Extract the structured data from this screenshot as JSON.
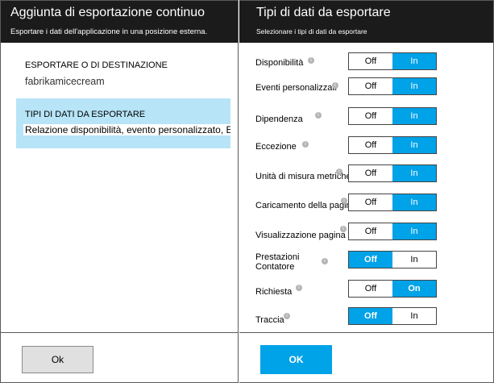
{
  "left_blade": {
    "title": "Aggiunta di esportazione continuo",
    "subtitle": "Esportare i dati dell'applicazione in una posizione esterna.",
    "destination": {
      "label": "ESPORTARE O DI DESTINAZIONE",
      "value": "fabrikamicecream"
    },
    "data_types": {
      "label": "TIPI DI DATI DA ESPORTARE",
      "value": "Relazione disponibilità, evento personalizzato, E"
    },
    "ok_label": "Ok"
  },
  "right_blade": {
    "title": "Tipi di dati da esportare",
    "subtitle": "Selezionare i tipi di dati da esportare",
    "off_label": "Off",
    "in_label": "In",
    "on_label": "On",
    "ok_label": "OK",
    "rows": [
      {
        "label": "Disponibilità",
        "selected": "In"
      },
      {
        "label": "Eventi personalizzati",
        "selected": "In"
      },
      {
        "label": "Dipendenza",
        "selected": "In"
      },
      {
        "label": "Eccezione",
        "selected": "In"
      },
      {
        "label": "Unità di misura metriche",
        "selected": "In"
      },
      {
        "label": "Caricamento della pagina",
        "selected": "In"
      },
      {
        "label": "Visualizzazione pagina",
        "selected": "In"
      },
      {
        "label": "Prestazioni Contatore",
        "selected": "Off"
      },
      {
        "label": "Richiesta",
        "selected": "On"
      },
      {
        "label": "Traccia",
        "selected": "Off"
      }
    ]
  },
  "colors": {
    "header_bg": "#1b1b1b",
    "accent": "#00a2e8",
    "selected_section": "#b7e4f7"
  },
  "icons": [
    "info-icon"
  ]
}
